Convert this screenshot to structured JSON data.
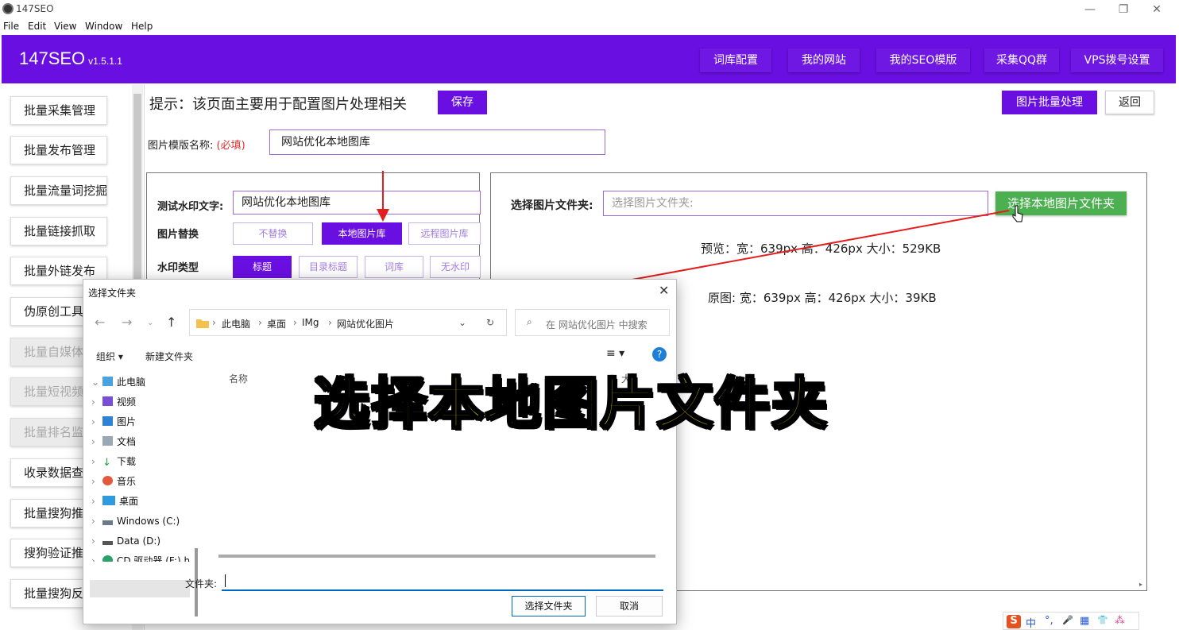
{
  "window": {
    "title": "147SEO",
    "menu": [
      "File",
      "Edit",
      "View",
      "Window",
      "Help"
    ],
    "controls": [
      "—",
      "❐",
      "✕"
    ]
  },
  "header": {
    "brand": "147SEO",
    "version": "v1.5.1.1",
    "nav": [
      "词库配置",
      "我的网站",
      "我的SEO模版",
      "采集QQ群",
      "VPS拨号设置"
    ],
    "accent_color": "#6a0fe2"
  },
  "sidebar": {
    "items": [
      {
        "label": "批量采集管理",
        "enabled": true
      },
      {
        "label": "批量发布管理",
        "enabled": true
      },
      {
        "label": "批量流量词挖掘",
        "enabled": true
      },
      {
        "label": "批量链接抓取",
        "enabled": true
      },
      {
        "label": "批量外链发布",
        "enabled": true
      },
      {
        "label": "伪原创工具",
        "enabled": true
      },
      {
        "label": "批量自媒体",
        "enabled": false
      },
      {
        "label": "批量短视频",
        "enabled": false
      },
      {
        "label": "批量排名监",
        "enabled": false
      },
      {
        "label": "收录数据查",
        "enabled": true
      },
      {
        "label": "批量搜狗推",
        "enabled": true
      },
      {
        "label": "搜狗验证推",
        "enabled": true
      },
      {
        "label": "批量搜狗反",
        "enabled": true
      }
    ]
  },
  "main": {
    "hint": "提示：该页面主要用于配置图片处理相关",
    "save_label": "保存",
    "batch_label": "图片批量处理",
    "back_label": "返回",
    "template_name_label": "图片模版名称:",
    "template_name_required": "(必填)",
    "template_name_value": "网站优化本地图库",
    "left": {
      "watermark_text_label": "测试水印文字:",
      "watermark_text_value": "网站优化本地图库",
      "replace_label": "图片替换",
      "replace_options": [
        {
          "label": "不替换",
          "selected": false
        },
        {
          "label": "本地图片库",
          "selected": true
        },
        {
          "label": "远程图片库",
          "selected": false
        }
      ],
      "watermark_type_label": "水印类型",
      "watermark_type_options": [
        {
          "label": "标题",
          "selected": true
        },
        {
          "label": "目录标题",
          "selected": false
        },
        {
          "label": "词库",
          "selected": false
        },
        {
          "label": "无水印",
          "selected": false
        }
      ]
    },
    "right": {
      "folder_label": "选择图片文件夹:",
      "folder_placeholder": "选择图片文件夹:",
      "choose_button": "选择本地图片文件夹",
      "preview_info": "预览：宽：639px 高：426px 大小：529KB",
      "original_info": "原图: 宽：639px 高：426px 大小：39KB"
    }
  },
  "dialog": {
    "title": "选择文件夹",
    "path": [
      "此电脑",
      "桌面",
      "IMg",
      "网站优化图片"
    ],
    "search_placeholder": "在 网站优化图片 中搜索",
    "organize": "组织 ▾",
    "new_folder": "新建文件夹",
    "tree": [
      {
        "label": "此电脑",
        "icon": "computer-icon",
        "expanded": true
      },
      {
        "label": "视频",
        "icon": "video-icon"
      },
      {
        "label": "图片",
        "icon": "pictures-icon"
      },
      {
        "label": "文档",
        "icon": "documents-icon"
      },
      {
        "label": "下载",
        "icon": "download-icon"
      },
      {
        "label": "音乐",
        "icon": "music-icon"
      },
      {
        "label": "桌面",
        "icon": "desktop-icon",
        "selected": true
      },
      {
        "label": "Windows (C:)",
        "icon": "drive-c-icon"
      },
      {
        "label": "Data (D:)",
        "icon": "drive-d-icon"
      },
      {
        "label": "CD 驱动器 (F:) h",
        "icon": "cd-drive-icon"
      }
    ],
    "column_name": "名称",
    "column_size": "大",
    "folder_label": "文件夹:",
    "folder_value": "",
    "select_button": "选择文件夹",
    "cancel_button": "取消"
  },
  "overlay_caption": "选择本地图片文件夹",
  "ime": {
    "items": [
      "S",
      "中",
      "°,",
      "🎤",
      "▦",
      "👕",
      "⁂"
    ]
  }
}
